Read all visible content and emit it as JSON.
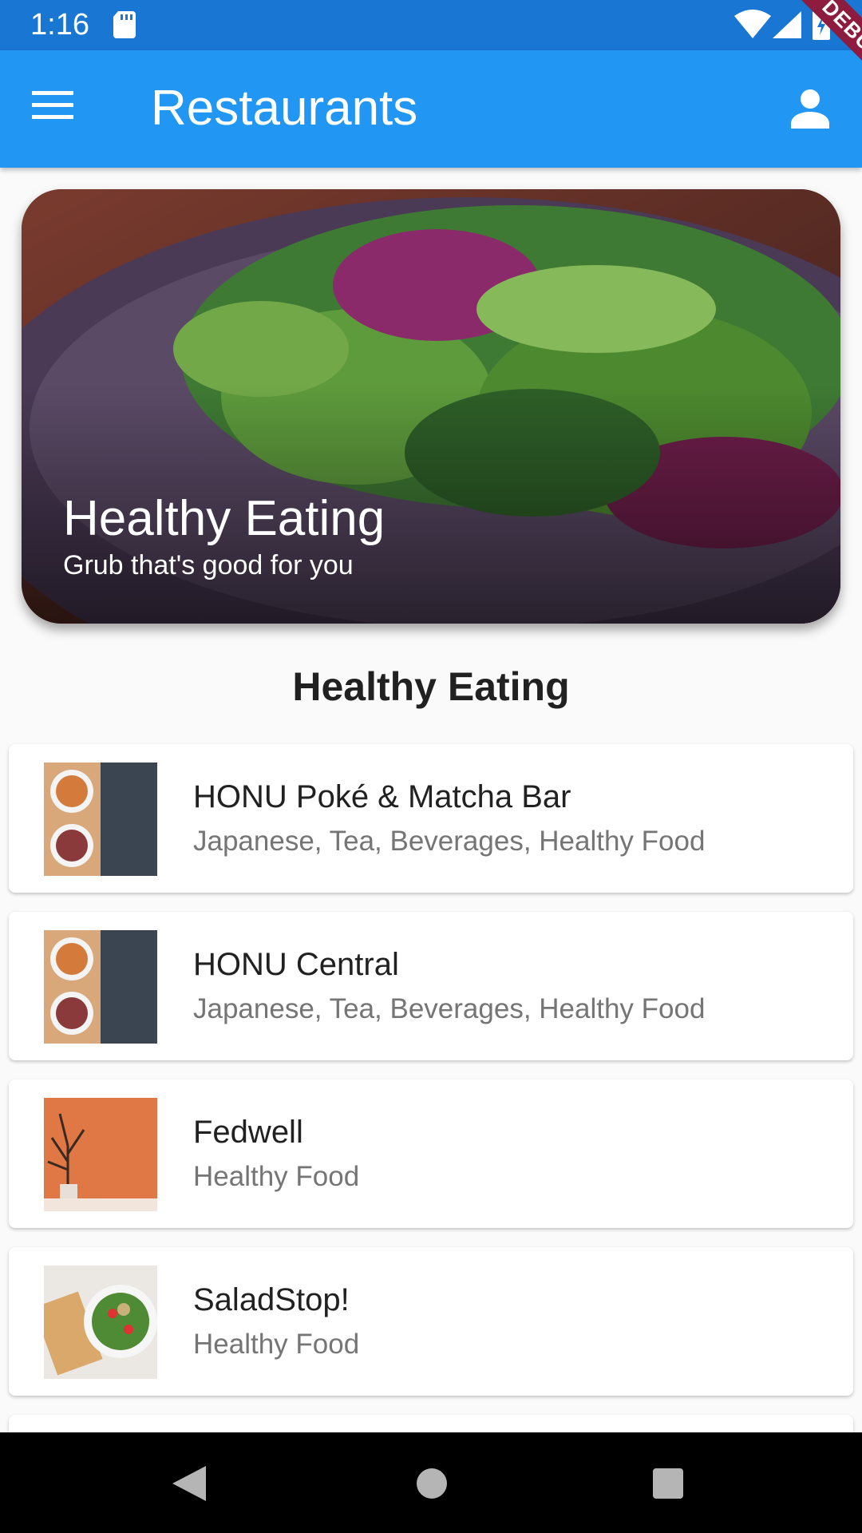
{
  "status_bar": {
    "time": "1:16",
    "icons": [
      "sd-card-icon",
      "wifi-icon",
      "signal-icon",
      "battery-icon"
    ]
  },
  "app_bar": {
    "title": "Restaurants",
    "left_icon": "menu-icon",
    "right_icon": "account-icon",
    "color": "#2196f3",
    "status_color": "#1976d2"
  },
  "debug_banner": "DEBUG",
  "hero": {
    "title": "Healthy Eating",
    "subtitle": "Grub that's good for you"
  },
  "section_title": "Healthy Eating",
  "restaurants": [
    {
      "name": "HONU Poké & Matcha Bar",
      "categories": "Japanese, Tea, Beverages, Healthy Food"
    },
    {
      "name": "HONU Central",
      "categories": "Japanese, Tea, Beverages, Healthy Food"
    },
    {
      "name": "Fedwell",
      "categories": "Healthy Food"
    },
    {
      "name": "SaladStop!",
      "categories": "Healthy Food"
    }
  ],
  "nav_bar": {
    "icons": [
      "back-icon",
      "home-icon",
      "recents-icon"
    ]
  }
}
